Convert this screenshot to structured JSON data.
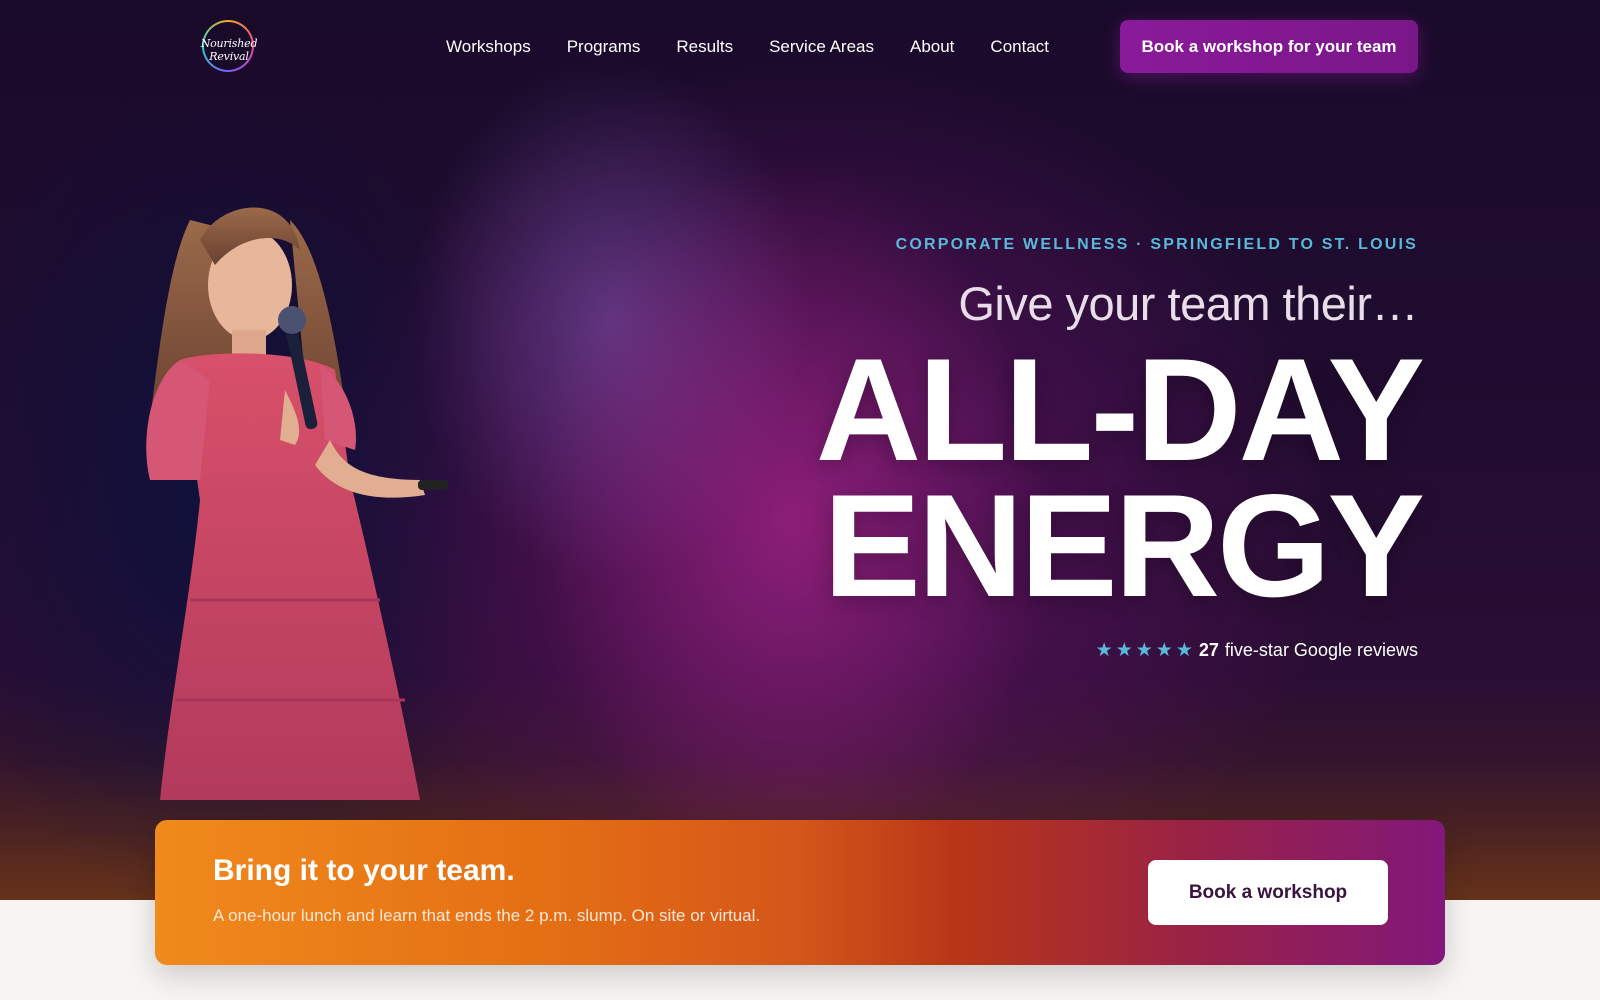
{
  "brand": {
    "logo_text": "Nourished Revival",
    "icon": "logo-ring"
  },
  "nav": {
    "items": [
      {
        "label": "Workshops"
      },
      {
        "label": "Programs"
      },
      {
        "label": "Results"
      },
      {
        "label": "Service Areas"
      },
      {
        "label": "About"
      },
      {
        "label": "Contact"
      }
    ],
    "cta_label": "Book a workshop for your team"
  },
  "hero": {
    "eyebrow": "CORPORATE WELLNESS · SPRINGFIELD TO ST. LOUIS",
    "lead": "Give your team their…",
    "headline_line1": "ALL-DAY",
    "headline_line2": "ENERGY",
    "rating": {
      "stars": 5,
      "count": "27",
      "text": "five-star Google reviews",
      "star_icon": "star-icon"
    },
    "image": "speaker-with-microphone"
  },
  "banner": {
    "title": "Bring it to your team.",
    "subtitle": "A one-hour lunch and learn that ends the 2 p.m. slump. On site or virtual.",
    "button_label": "Book a workshop"
  },
  "colors": {
    "accent_purple": "#8a1a9a",
    "eyebrow_blue": "#5ab8d8",
    "banner_orange": "#f08a1c",
    "banner_purple": "#82187a"
  }
}
